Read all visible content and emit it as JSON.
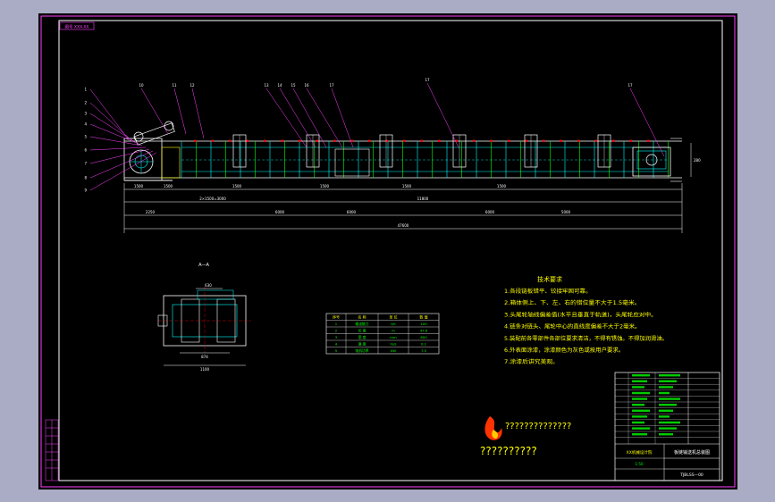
{
  "frame": {
    "corner_tag": "图号 XXX-XX"
  },
  "balloons": [
    "1",
    "2",
    "3",
    "4",
    "5",
    "6",
    "7",
    "8",
    "9",
    "10",
    "11",
    "12",
    "13",
    "14",
    "15",
    "16",
    "17"
  ],
  "dimensions": {
    "row1": [
      "1500",
      "1500",
      "1500",
      "1500",
      "1500",
      "1500"
    ],
    "pitch_note": "2×1500=3000",
    "row2": [
      "2250",
      "6000",
      "6000",
      "6000",
      "5000"
    ],
    "overall": "47600",
    "mid": "11800",
    "height_right": "280"
  },
  "section_view": {
    "label": "A—A",
    "dim_top": "630",
    "dim_bottom": "874",
    "dim_overall": "1100"
  },
  "param_table": {
    "headers": [
      "序号",
      "名 称",
      "单 位",
      "数 值"
    ],
    "rows": [
      [
        "1",
        "输送能力",
        "t/h",
        "100"
      ],
      [
        "2",
        "长 度",
        "m",
        "47.6"
      ],
      [
        "3",
        "宽 度",
        "mm",
        "800"
      ],
      [
        "4",
        "速 度",
        "m/s",
        "0.1"
      ],
      [
        "5",
        "电机功率",
        "kW",
        "7.5"
      ]
    ]
  },
  "tech_requirements": {
    "title": "技术要求",
    "items": [
      "1.各段链板错平、铰接牢固可靠。",
      "2.箱体侧上、下、左、右的错位量不大于1.5毫米。",
      "3.头尾轮轴线偏差值(水平且垂直于轨道)，头尾轮应对中。",
      "4.链条对链头、尾轮中心的直线度偏差不大于2毫米。",
      "5.装配前各零部件各部位要求清洁，不得有锈蚀。不得加润滑油。",
      "6.外表面涂漆，涂漆颜色为灰色或按用户要求。",
      "7.涂漆后讲究美观。"
    ]
  },
  "watermark": {
    "line1": "??????????????",
    "line2": "??????????"
  },
  "title_block": {
    "product": "板链输送机总装图",
    "company": "XX机械设计院",
    "drawing_no": "TJBLSS—00",
    "scale": "1:50"
  }
}
